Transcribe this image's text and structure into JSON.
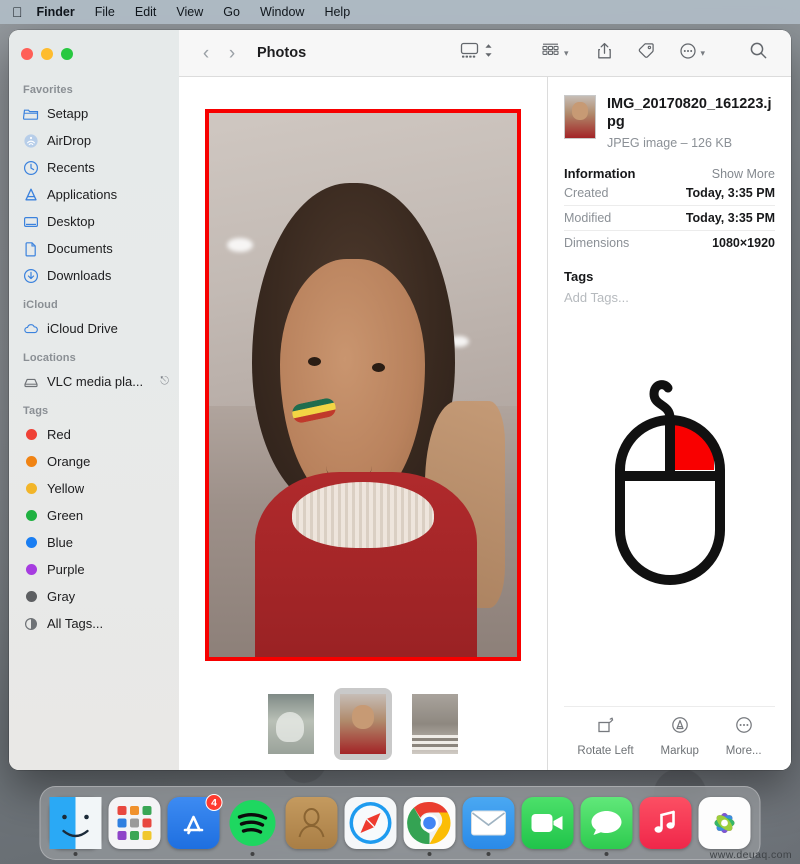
{
  "menubar": {
    "apple_icon": "apple-logo",
    "items": [
      {
        "label": "Finder",
        "bold": true
      },
      {
        "label": "File",
        "bold": false
      },
      {
        "label": "Edit",
        "bold": false
      },
      {
        "label": "View",
        "bold": false
      },
      {
        "label": "Go",
        "bold": false
      },
      {
        "label": "Window",
        "bold": false
      },
      {
        "label": "Help",
        "bold": false
      }
    ]
  },
  "window": {
    "title": "Photos",
    "traffic_lights": [
      "close",
      "minimize",
      "zoom"
    ]
  },
  "toolbar": {
    "back_icon": "chevron-left-icon",
    "forward_icon": "chevron-right-icon",
    "title": "Photos",
    "view_icon": "gallery-view-icon",
    "stepper_icon": "up-down-chevrons-icon",
    "group_icon": "group-by-icon",
    "share_icon": "share-icon",
    "tag_icon": "tag-icon",
    "more_icon": "more-circle-icon",
    "search_icon": "search-icon"
  },
  "sidebar": {
    "sections": [
      {
        "title": "Favorites",
        "items": [
          {
            "label": "Setapp",
            "icon": "folder-icon"
          },
          {
            "label": "AirDrop",
            "icon": "airdrop-icon"
          },
          {
            "label": "Recents",
            "icon": "clock-icon"
          },
          {
            "label": "Applications",
            "icon": "applications-icon"
          },
          {
            "label": "Desktop",
            "icon": "desktop-icon"
          },
          {
            "label": "Documents",
            "icon": "document-icon"
          },
          {
            "label": "Downloads",
            "icon": "download-icon"
          }
        ]
      },
      {
        "title": "iCloud",
        "items": [
          {
            "label": "iCloud Drive",
            "icon": "cloud-icon"
          }
        ]
      },
      {
        "title": "Locations",
        "items": [
          {
            "label": "VLC media pla...",
            "icon": "disk-icon",
            "eject": true
          }
        ]
      },
      {
        "title": "Tags",
        "items": [
          {
            "label": "Red",
            "icon": "tag-dot",
            "color": "#ef4136"
          },
          {
            "label": "Orange",
            "icon": "tag-dot",
            "color": "#f08313"
          },
          {
            "label": "Yellow",
            "icon": "tag-dot",
            "color": "#f2b529"
          },
          {
            "label": "Green",
            "icon": "tag-dot",
            "color": "#1fb141"
          },
          {
            "label": "Blue",
            "icon": "tag-dot",
            "color": "#1a7ef2"
          },
          {
            "label": "Purple",
            "icon": "tag-dot",
            "color": "#a63ce0"
          },
          {
            "label": "Gray",
            "icon": "tag-dot",
            "color": "#5d5f62"
          },
          {
            "label": "All Tags...",
            "icon": "all-tags-icon",
            "color": "#6e7276"
          }
        ]
      }
    ]
  },
  "preview": {
    "selection_border_color": "#f70000",
    "thumbnails": [
      {
        "name": "thumbnail-1",
        "selected": false
      },
      {
        "name": "thumbnail-2",
        "selected": true
      },
      {
        "name": "thumbnail-3",
        "selected": false
      }
    ]
  },
  "info": {
    "file_name": "IMG_20170820_161223.jpg",
    "file_meta": "JPEG image – 126 KB",
    "information_title": "Information",
    "show_more": "Show More",
    "rows": [
      {
        "key": "Created",
        "value": "Today, 3:35 PM"
      },
      {
        "key": "Modified",
        "value": "Today, 3:35 PM"
      },
      {
        "key": "Dimensions",
        "value": "1080×1920"
      }
    ],
    "tags_title": "Tags",
    "add_tags_placeholder": "Add Tags...",
    "mouse_illustration": {
      "name": "mouse-right-click-illustration",
      "highlight_color": "#f90000",
      "highlighted_button": "right"
    },
    "actions": [
      {
        "label": "Rotate Left",
        "icon": "rotate-left-icon"
      },
      {
        "label": "Markup",
        "icon": "markup-icon"
      },
      {
        "label": "More...",
        "icon": "more-circle-icon"
      }
    ]
  },
  "dock": {
    "apps": [
      {
        "name": "finder",
        "label": "Finder",
        "running": true
      },
      {
        "name": "launchpad",
        "label": "Launchpad",
        "running": false
      },
      {
        "name": "app-store",
        "label": "App Store",
        "badge": "4",
        "running": false
      },
      {
        "name": "spotify",
        "label": "Spotify",
        "running": true
      },
      {
        "name": "contacts",
        "label": "Contacts",
        "running": false
      },
      {
        "name": "safari",
        "label": "Safari",
        "running": false
      },
      {
        "name": "chrome",
        "label": "Google Chrome",
        "running": true
      },
      {
        "name": "mail",
        "label": "Mail",
        "running": true
      },
      {
        "name": "facetime",
        "label": "FaceTime",
        "running": false
      },
      {
        "name": "messages",
        "label": "Messages",
        "running": true
      },
      {
        "name": "music",
        "label": "Music",
        "running": false
      },
      {
        "name": "photos",
        "label": "Photos",
        "running": false
      }
    ]
  },
  "watermark": "www.deuaq.com"
}
